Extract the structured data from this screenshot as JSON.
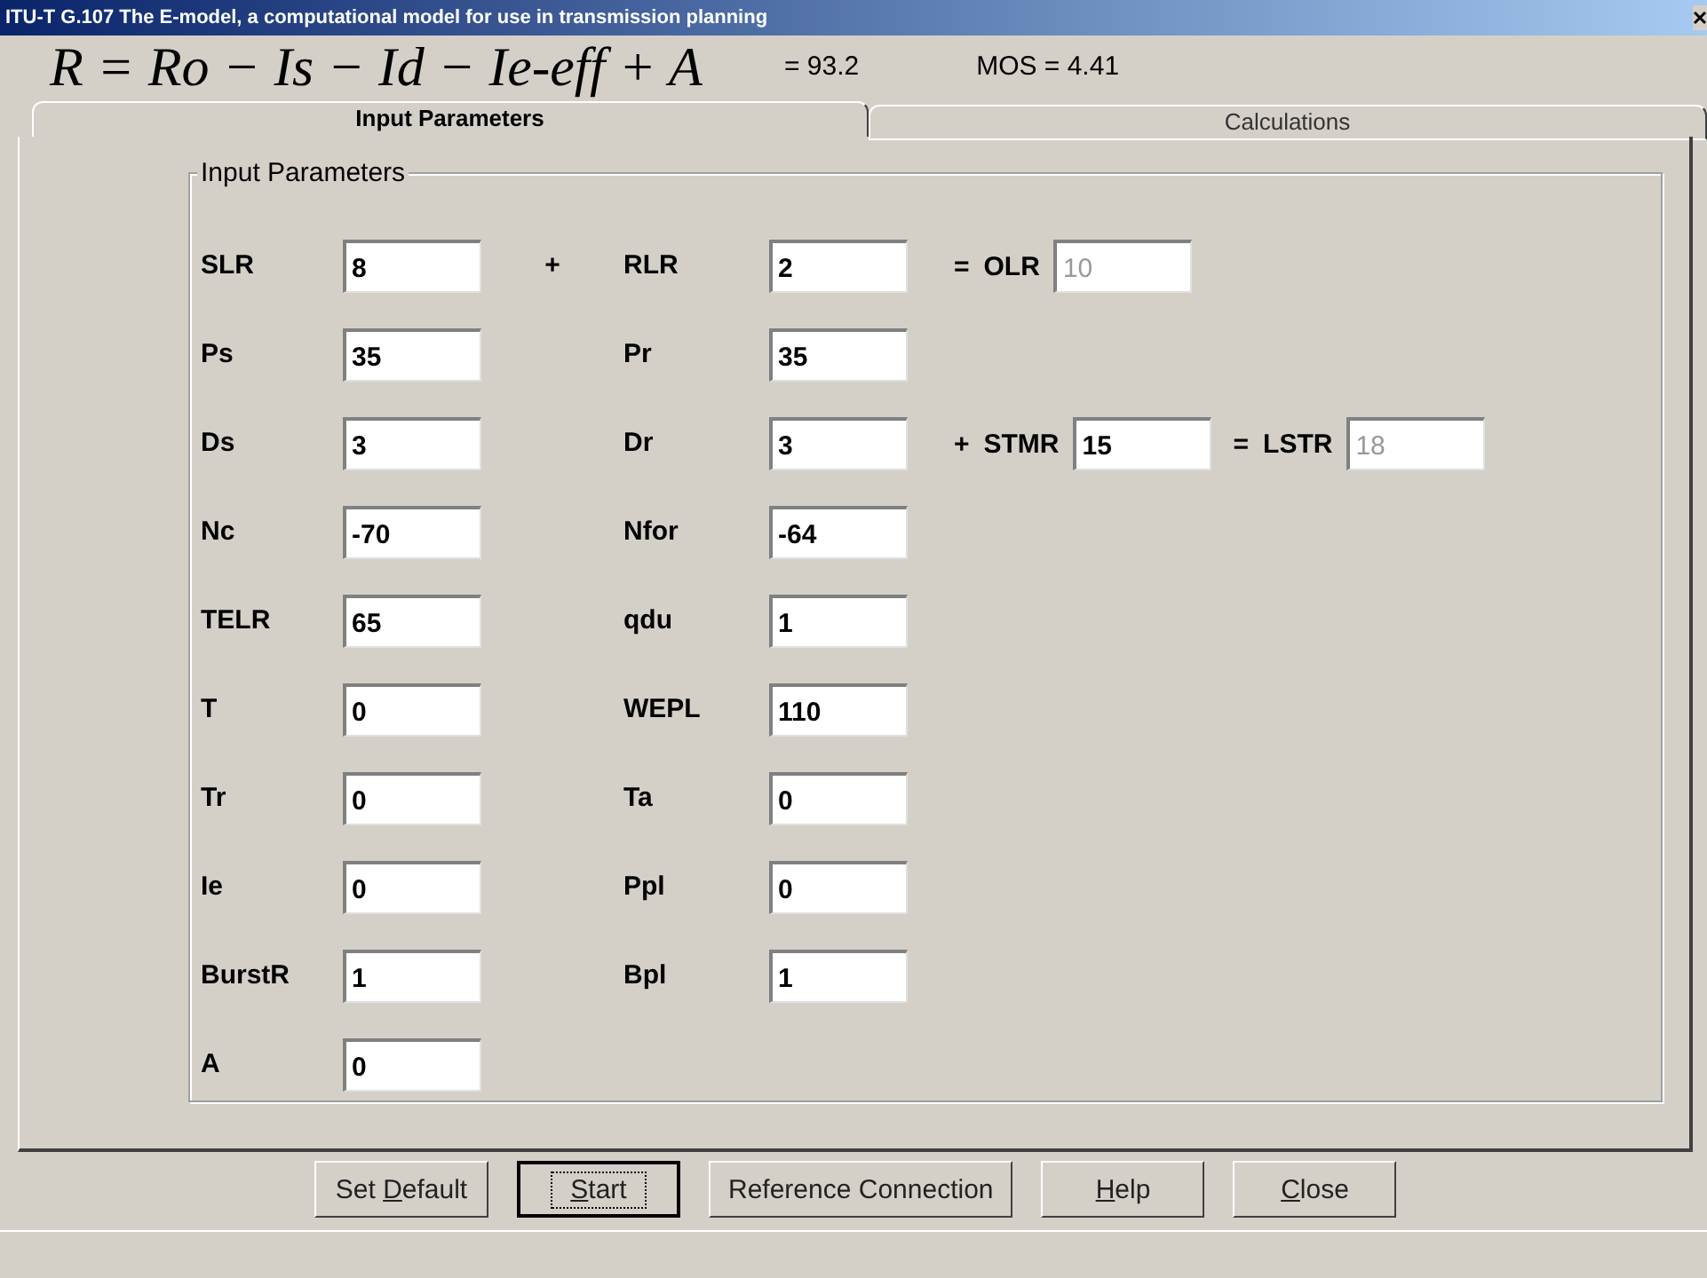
{
  "window": {
    "title": "ITU-T G.107  The E-model, a computational model for use in transmission planning"
  },
  "formula": {
    "text": "R = Ro − Is − Id − Ie-eff + A",
    "result": "= 93.2",
    "mos": "MOS = 4.41"
  },
  "tabs": [
    {
      "label": "Input Parameters",
      "selected": true
    },
    {
      "label": "Calculations",
      "selected": false
    }
  ],
  "group": {
    "title": "Input Parameters",
    "rows": [
      {
        "left": {
          "label": "SLR",
          "value": "8"
        },
        "join": "+",
        "right": {
          "label": "RLR",
          "value": "2"
        },
        "extra": [
          {
            "kind": "text",
            "text": "="
          },
          {
            "kind": "text",
            "text": "OLR"
          },
          {
            "kind": "field",
            "value": "10",
            "disabled": true
          }
        ]
      },
      {
        "left": {
          "label": "Ps",
          "value": "35"
        },
        "right": {
          "label": "Pr",
          "value": "35"
        }
      },
      {
        "left": {
          "label": "Ds",
          "value": "3"
        },
        "right": {
          "label": "Dr",
          "value": "3"
        },
        "extra": [
          {
            "kind": "text",
            "text": "+"
          },
          {
            "kind": "text",
            "text": "STMR"
          },
          {
            "kind": "field",
            "value": "15",
            "disabled": false
          },
          {
            "kind": "text",
            "text": "="
          },
          {
            "kind": "text",
            "text": "LSTR"
          },
          {
            "kind": "field",
            "value": "18",
            "disabled": true
          }
        ]
      },
      {
        "left": {
          "label": "Nc",
          "value": "-70"
        },
        "right": {
          "label": "Nfor",
          "value": "-64"
        }
      },
      {
        "left": {
          "label": "TELR",
          "value": "65"
        },
        "right": {
          "label": "qdu",
          "value": "1"
        }
      },
      {
        "left": {
          "label": "T",
          "value": "0"
        },
        "right": {
          "label": "WEPL",
          "value": "110"
        }
      },
      {
        "left": {
          "label": "Tr",
          "value": "0"
        },
        "right": {
          "label": "Ta",
          "value": "0"
        }
      },
      {
        "left": {
          "label": "Ie",
          "value": "0"
        },
        "right": {
          "label": "Ppl",
          "value": "0"
        }
      },
      {
        "left": {
          "label": "BurstR",
          "value": "1"
        },
        "right": {
          "label": "Bpl",
          "value": "1"
        }
      },
      {
        "left": {
          "label": "A",
          "value": "0"
        }
      }
    ]
  },
  "buttons": [
    {
      "before": "Set ",
      "key": "D",
      "after": "efault",
      "default": false
    },
    {
      "key": "S",
      "after": "tart",
      "default": true
    },
    {
      "before": "Reference Connection",
      "default": false
    },
    {
      "key": "H",
      "after": "elp",
      "default": false
    },
    {
      "key": "C",
      "after": "lose",
      "default": false
    }
  ]
}
